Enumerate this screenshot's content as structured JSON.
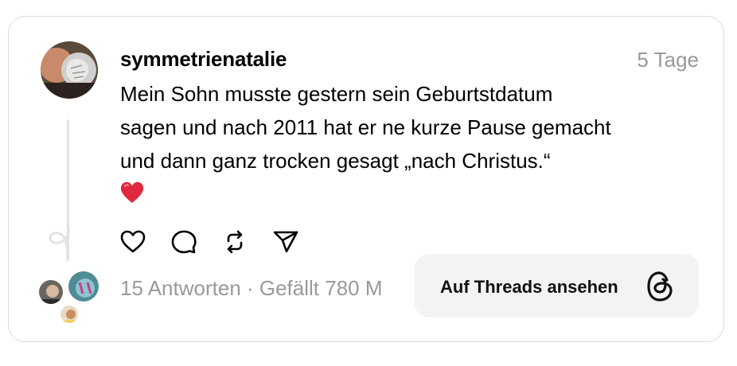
{
  "post": {
    "username": "symmetrienatalie",
    "time": "5 Tage",
    "text_lines": [
      "Mein Sohn musste gestern sein Geburtstdatum",
      "sagen und nach 2011 hat er ne kurze Pause gemacht",
      "und dann ganz trocken gesagt „nach Christus.“"
    ],
    "emoji": "heart-emoji"
  },
  "actions": [
    "heart-icon",
    "comment-icon",
    "repost-icon",
    "share-icon"
  ],
  "footer": {
    "stats": "15 Antworten · Gefällt 780 M",
    "threads_button": "Auf Threads ansehen",
    "threads_icon": "threads-logo-icon"
  },
  "colors": {
    "secondary_text": "#999999",
    "border": "#dadada",
    "button_bg": "#f3f3f3",
    "heart": "#e0283c"
  }
}
